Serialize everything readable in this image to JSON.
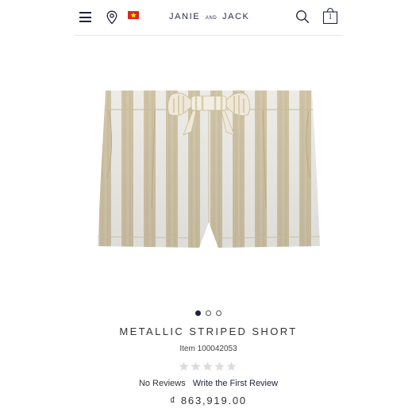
{
  "header": {
    "logo_main_left": "JANIE",
    "logo_and": "AND",
    "logo_main_right": "JACK",
    "bag_count": "1",
    "icons": [
      "menu-icon",
      "location-pin-icon",
      "vietnam-flag-icon",
      "search-icon",
      "shopping-bag-icon"
    ]
  },
  "product": {
    "title": "METALLIC STRIPED SHORT",
    "item_number": "Item 100042053",
    "rating": 0,
    "max_rating": 5,
    "reviews_label": "No Reviews",
    "write_review_label": "Write the First Review",
    "price": "₫ 863,919.00",
    "carousel": {
      "count": 3,
      "active": 0
    }
  },
  "colors": {
    "navy": "#1d2240",
    "stripe_tan": "#d9ccae",
    "stripe_white": "#f7f5f0",
    "star_empty": "#dcdcdc",
    "flag_red": "#da251d",
    "flag_star": "#ffff00"
  }
}
